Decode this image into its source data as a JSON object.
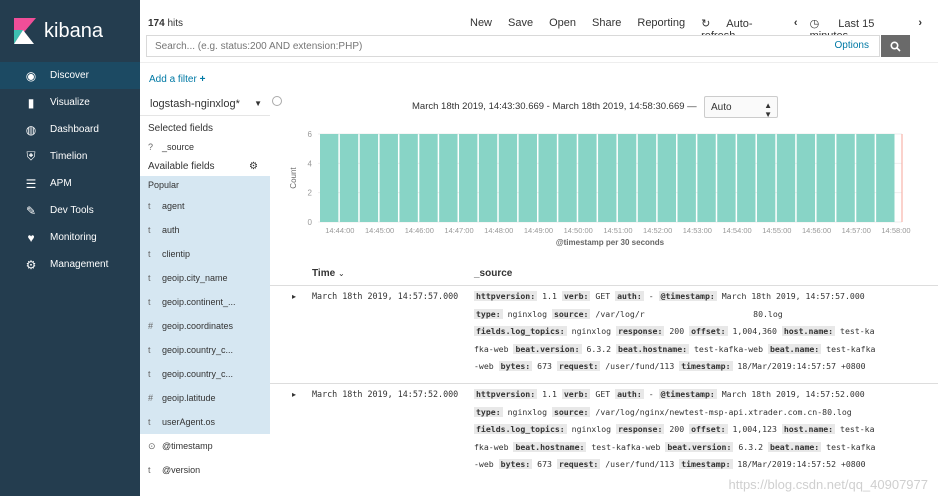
{
  "brand": "kibana",
  "nav": [
    {
      "label": "Discover",
      "icon": "compass-icon",
      "active": true
    },
    {
      "label": "Visualize",
      "icon": "bar-chart-icon"
    },
    {
      "label": "Dashboard",
      "icon": "dashboard-icon"
    },
    {
      "label": "Timelion",
      "icon": "shield-icon"
    },
    {
      "label": "APM",
      "icon": "apm-icon"
    },
    {
      "label": "Dev Tools",
      "icon": "wrench-icon"
    },
    {
      "label": "Monitoring",
      "icon": "heartbeat-icon"
    },
    {
      "label": "Management",
      "icon": "gear-icon"
    }
  ],
  "top": {
    "hits_count": "174",
    "hits_label": "hits",
    "menu": [
      "New",
      "Save",
      "Open",
      "Share",
      "Reporting",
      "Auto-refresh",
      "Last 15 minutes"
    ],
    "search_placeholder": "Search... (e.g. status:200 AND extension:PHP)",
    "options_label": "Options"
  },
  "filter": {
    "add_label": "Add a filter"
  },
  "fields": {
    "index_pattern": "logstash-nginxlog*",
    "selected_title": "Selected fields",
    "selected": [
      {
        "type": "?",
        "name": "_source"
      }
    ],
    "available_title": "Available fields",
    "popular_title": "Popular",
    "popular": [
      {
        "type": "t",
        "name": "agent"
      },
      {
        "type": "t",
        "name": "auth"
      },
      {
        "type": "t",
        "name": "clientip"
      },
      {
        "type": "t",
        "name": "geoip.city_name"
      },
      {
        "type": "t",
        "name": "geoip.continent_..."
      },
      {
        "type": "#",
        "name": "geoip.coordinates"
      },
      {
        "type": "t",
        "name": "geoip.country_c..."
      },
      {
        "type": "t",
        "name": "geoip.country_c..."
      },
      {
        "type": "#",
        "name": "geoip.latitude"
      },
      {
        "type": "t",
        "name": "userAgent.os"
      }
    ],
    "other": [
      {
        "type": "⊙",
        "name": "@timestamp"
      },
      {
        "type": "t",
        "name": "@version"
      }
    ]
  },
  "main": {
    "time_range": "March 18th 2019, 14:43:30.669 - March 18th 2019, 14:58:30.669 —",
    "interval": "Auto",
    "col_time": "Time",
    "col_source": "_source"
  },
  "chart_data": {
    "type": "bar",
    "categories": [
      "14:44:00",
      "14:44:30",
      "14:45:00",
      "14:45:30",
      "14:46:00",
      "14:46:30",
      "14:47:00",
      "14:47:30",
      "14:48:00",
      "14:48:30",
      "14:49:00",
      "14:49:30",
      "14:50:00",
      "14:50:30",
      "14:51:00",
      "14:51:30",
      "14:52:00",
      "14:52:30",
      "14:53:00",
      "14:53:30",
      "14:54:00",
      "14:54:30",
      "14:55:00",
      "14:55:30",
      "14:56:00",
      "14:56:30",
      "14:57:00",
      "14:57:30",
      "14:58:00"
    ],
    "x_tick_labels": [
      "14:44:00",
      "14:45:00",
      "14:46:00",
      "14:47:00",
      "14:48:00",
      "14:49:00",
      "14:50:00",
      "14:51:00",
      "14:52:00",
      "14:53:00",
      "14:54:00",
      "14:55:00",
      "14:56:00",
      "14:57:00",
      "14:58:00"
    ],
    "values": [
      6,
      6,
      6,
      6,
      6,
      6,
      6,
      6,
      6,
      6,
      6,
      6,
      6,
      6,
      6,
      6,
      6,
      6,
      6,
      6,
      6,
      6,
      6,
      6,
      6,
      6,
      6,
      6,
      6
    ],
    "y_ticks": [
      0,
      2,
      4,
      6
    ],
    "xlabel": "@timestamp per 30 seconds",
    "ylabel": "Count",
    "ylim": [
      0,
      6
    ],
    "bar_color": "#88d4c6"
  },
  "docs": [
    {
      "time": "March 18th 2019, 14:57:57.000",
      "lines": [
        [
          [
            "k",
            "httpversion:"
          ],
          [
            "v",
            " 1.1 "
          ],
          [
            "k",
            "verb:"
          ],
          [
            "v",
            " GET "
          ],
          [
            "k",
            "auth:"
          ],
          [
            "v",
            " - "
          ],
          [
            "k",
            "@timestamp:"
          ],
          [
            "v",
            " March 18th 2019, 14:57:57.000"
          ]
        ],
        [
          [
            "k",
            "type:"
          ],
          [
            "v",
            " nginxlog "
          ],
          [
            "k",
            "source:"
          ],
          [
            "v",
            " /var/log/r                      80.log"
          ]
        ],
        [
          [
            "k",
            "fields.log_topics:"
          ],
          [
            "v",
            " nginxlog "
          ],
          [
            "k",
            "response:"
          ],
          [
            "v",
            " 200 "
          ],
          [
            "k",
            "offset:"
          ],
          [
            "v",
            " 1,004,360 "
          ],
          [
            "k",
            "host.name:"
          ],
          [
            "v",
            " test-ka"
          ]
        ],
        [
          [
            "v",
            "fka-web "
          ],
          [
            "k",
            "beat.version:"
          ],
          [
            "v",
            " 6.3.2 "
          ],
          [
            "k",
            "beat.hostname:"
          ],
          [
            "v",
            " test-kafka-web "
          ],
          [
            "k",
            "beat.name:"
          ],
          [
            "v",
            " test-kafka"
          ]
        ],
        [
          [
            "v",
            "-web "
          ],
          [
            "k",
            "bytes:"
          ],
          [
            "v",
            " 673 "
          ],
          [
            "k",
            "request:"
          ],
          [
            "v",
            " /user/fund/113 "
          ],
          [
            "k",
            "timestamp:"
          ],
          [
            "v",
            " 18/Mar/2019:14:57:57 +0800"
          ]
        ]
      ]
    },
    {
      "time": "March 18th 2019, 14:57:52.000",
      "lines": [
        [
          [
            "k",
            "httpversion:"
          ],
          [
            "v",
            " 1.1 "
          ],
          [
            "k",
            "verb:"
          ],
          [
            "v",
            " GET "
          ],
          [
            "k",
            "auth:"
          ],
          [
            "v",
            " - "
          ],
          [
            "k",
            "@timestamp:"
          ],
          [
            "v",
            " March 18th 2019, 14:57:52.000"
          ]
        ],
        [
          [
            "k",
            "type:"
          ],
          [
            "v",
            " nginxlog "
          ],
          [
            "k",
            "source:"
          ],
          [
            "v",
            " /var/log/nginx/newtest-msp-api.xtrader.com.cn-80.log"
          ]
        ],
        [
          [
            "k",
            "fields.log_topics:"
          ],
          [
            "v",
            " nginxlog "
          ],
          [
            "k",
            "response:"
          ],
          [
            "v",
            " 200 "
          ],
          [
            "k",
            "offset:"
          ],
          [
            "v",
            " 1,004,123 "
          ],
          [
            "k",
            "host.name:"
          ],
          [
            "v",
            " test-ka"
          ]
        ],
        [
          [
            "v",
            "fka-web "
          ],
          [
            "k",
            "beat.hostname:"
          ],
          [
            "v",
            " test-kafka-web "
          ],
          [
            "k",
            "beat.version:"
          ],
          [
            "v",
            " 6.3.2 "
          ],
          [
            "k",
            "beat.name:"
          ],
          [
            "v",
            " test-kafka"
          ]
        ],
        [
          [
            "v",
            "-web "
          ],
          [
            "k",
            "bytes:"
          ],
          [
            "v",
            " 673 "
          ],
          [
            "k",
            "request:"
          ],
          [
            "v",
            " /user/fund/113 "
          ],
          [
            "k",
            "timestamp:"
          ],
          [
            "v",
            " 18/Mar/2019:14:57:52 +0800"
          ]
        ]
      ]
    }
  ],
  "watermark": "https://blog.csdn.net/qq_40907977"
}
